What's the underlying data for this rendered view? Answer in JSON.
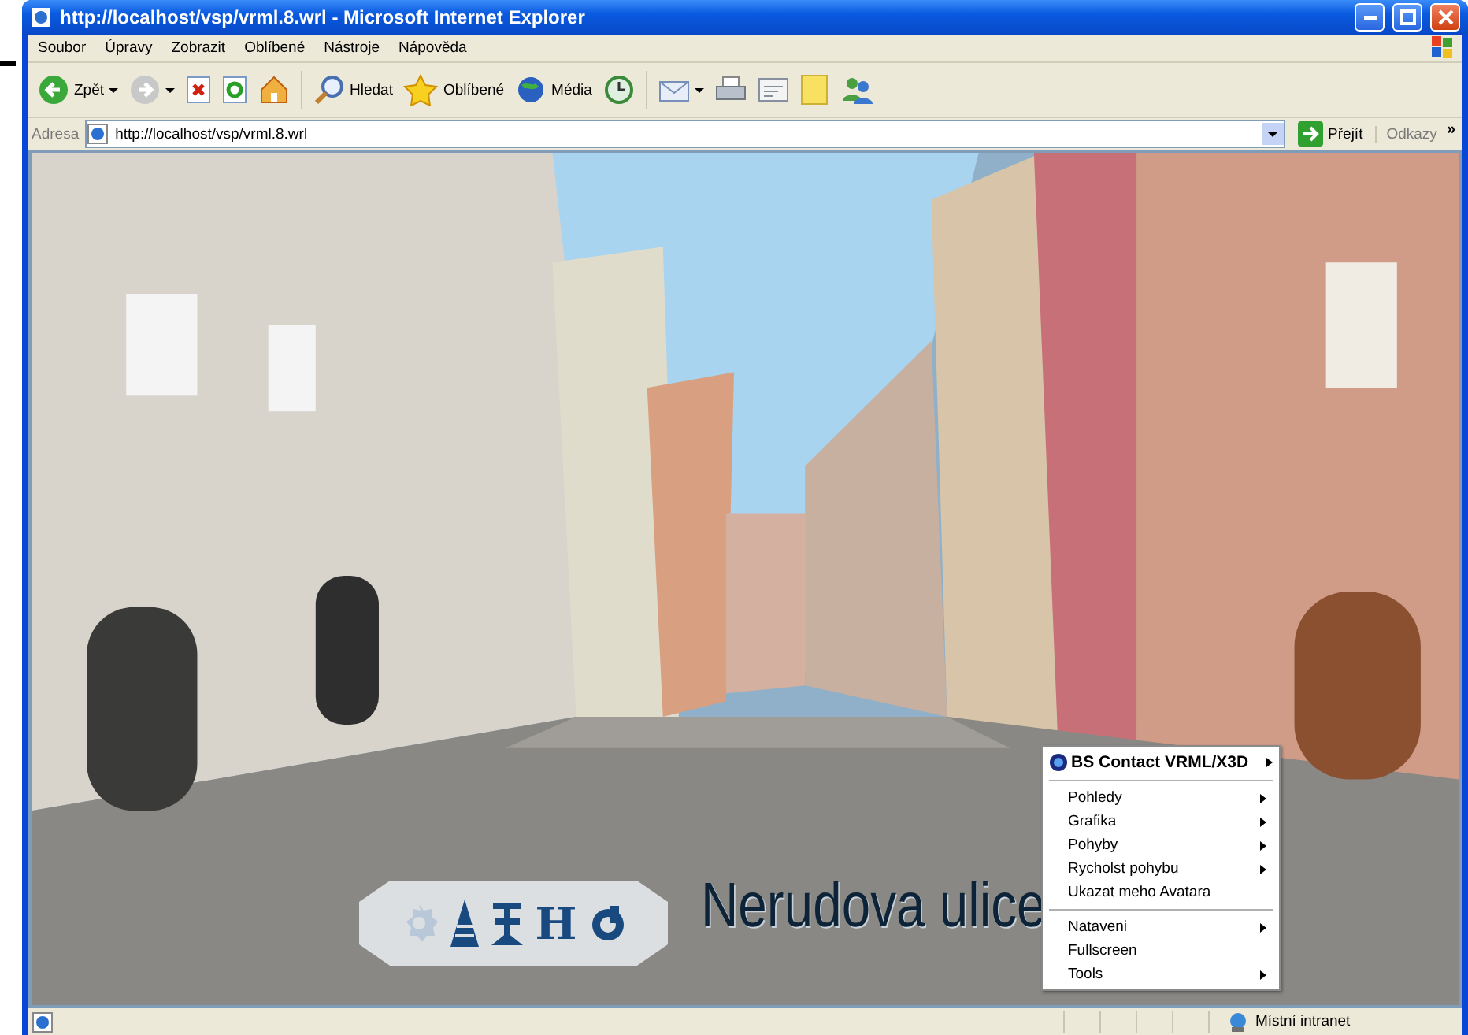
{
  "window": {
    "title": "http://localhost/vsp/vrml.8.wrl - Microsoft Internet Explorer"
  },
  "menu_bar": [
    "Soubor",
    "Úpravy",
    "Zobrazit",
    "Oblíbené",
    "Nástroje",
    "Nápověda"
  ],
  "toolbar": [
    {
      "kind": "back",
      "label": "Zpět",
      "dropdown": true
    },
    {
      "kind": "forward",
      "dropdown": true
    },
    {
      "kind": "stop"
    },
    {
      "kind": "refresh"
    },
    {
      "kind": "home"
    },
    {
      "kind": "search",
      "label": "Hledat"
    },
    {
      "kind": "favorites",
      "label": "Oblíbené"
    },
    {
      "kind": "media",
      "label": "Média"
    },
    {
      "kind": "history"
    },
    {
      "kind": "mail",
      "dropdown": true
    },
    {
      "kind": "print"
    },
    {
      "kind": "edit"
    },
    {
      "kind": "note"
    },
    {
      "kind": "messenger"
    }
  ],
  "address_bar": {
    "label": "Adresa",
    "value": "http://localhost/vsp/vrml.8.wrl",
    "go_button": "Přejít",
    "links": "Odkazy",
    "more": "»"
  },
  "scene": {
    "title": "Nerudova ulice",
    "nav_buttons": [
      {
        "kind": "gear",
        "disabled": true
      },
      {
        "kind": "walk",
        "disabled": false
      },
      {
        "kind": "figure",
        "disabled": false
      },
      {
        "kind": "letter",
        "label": "H",
        "disabled": false
      },
      {
        "kind": "power",
        "disabled": false
      }
    ]
  },
  "context_menu": {
    "header": "BS Contact VRML/X3D",
    "items": [
      {
        "kind": "separator"
      },
      {
        "kind": "item",
        "label": "Pohledy",
        "submenu": true
      },
      {
        "kind": "item",
        "label": "Grafika",
        "submenu": true
      },
      {
        "kind": "item",
        "label": "Pohyby",
        "submenu": true
      },
      {
        "kind": "item",
        "label": "Rycholst pohybu",
        "submenu": true
      },
      {
        "kind": "item",
        "label": "Ukazat meho Avatara",
        "submenu": false
      },
      {
        "kind": "separator"
      },
      {
        "kind": "item",
        "label": "Nataveni",
        "submenu": true
      },
      {
        "kind": "item",
        "label": "Fullscreen",
        "submenu": false
      },
      {
        "kind": "item",
        "label": "Tools",
        "submenu": true
      }
    ]
  },
  "status_bar": {
    "zone": "Místní intranet"
  }
}
